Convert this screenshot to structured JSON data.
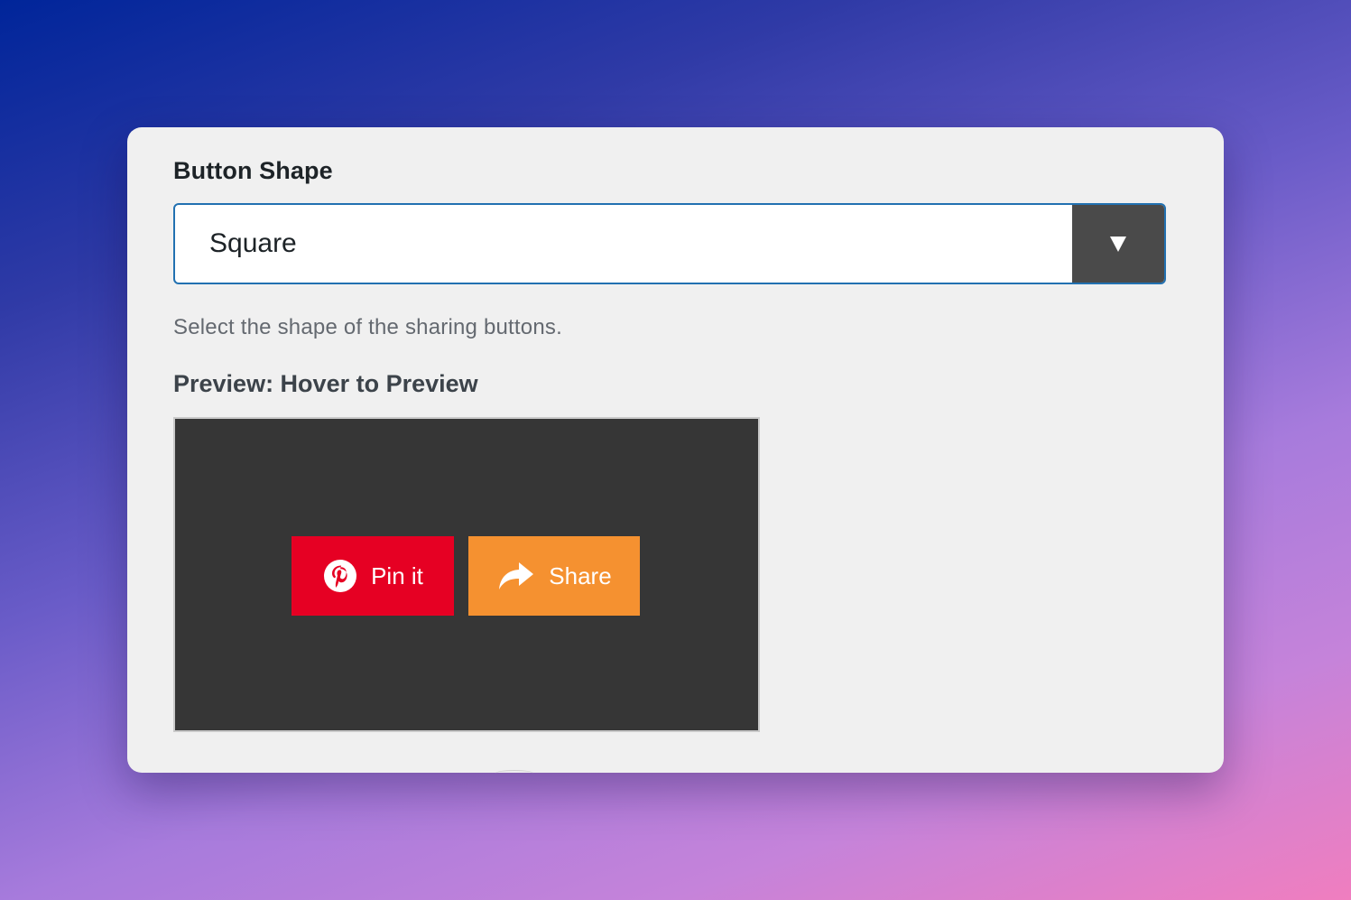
{
  "field": {
    "label": "Button Shape",
    "selected_value": "Square",
    "help_text": "Select the shape of the sharing buttons."
  },
  "preview": {
    "label": "Preview: Hover to Preview",
    "buttons": [
      {
        "label": "Pin it",
        "icon": "pinterest-icon",
        "color": "#e60023"
      },
      {
        "label": "Share",
        "icon": "share-arrow-icon",
        "color": "#f59130"
      }
    ]
  },
  "colors": {
    "select_border": "#2271b1",
    "arrow_box": "#4a4a4a",
    "preview_bg": "#363636"
  }
}
